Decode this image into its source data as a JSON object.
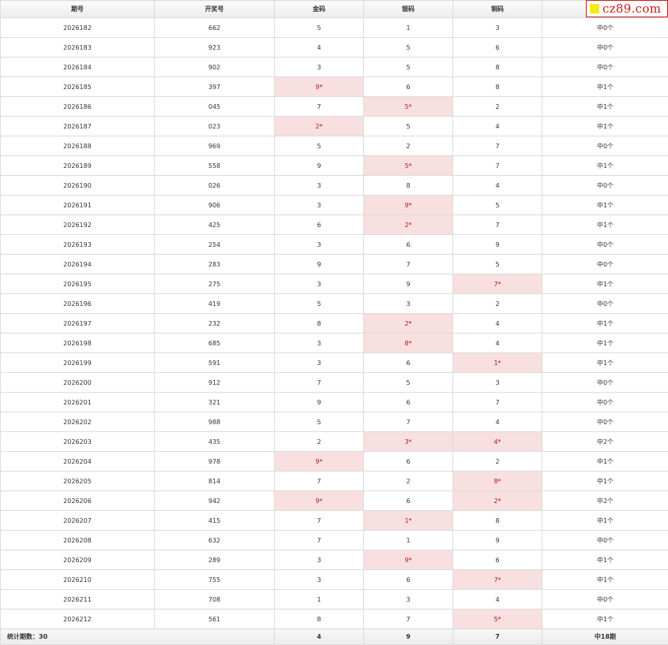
{
  "header": {
    "period": "期号",
    "draw": "开奖号",
    "gold": "金码",
    "silver": "银码",
    "copper": "铜码"
  },
  "watermark": "cz89.com",
  "rows": [
    {
      "p": "2026182",
      "n": "662",
      "g": "5",
      "s": "1",
      "c": "3",
      "r": "中0个",
      "h": ""
    },
    {
      "p": "2026183",
      "n": "923",
      "g": "4",
      "s": "5",
      "c": "6",
      "r": "中0个",
      "h": ""
    },
    {
      "p": "2026184",
      "n": "902",
      "g": "3",
      "s": "5",
      "c": "8",
      "r": "中0个",
      "h": ""
    },
    {
      "p": "2026185",
      "n": "397",
      "g": "9*",
      "s": "6",
      "c": "8",
      "r": "中1个",
      "h": "g"
    },
    {
      "p": "2026186",
      "n": "045",
      "g": "7",
      "s": "5*",
      "c": "2",
      "r": "中1个",
      "h": "s"
    },
    {
      "p": "2026187",
      "n": "023",
      "g": "2*",
      "s": "5",
      "c": "4",
      "r": "中1个",
      "h": "g"
    },
    {
      "p": "2026188",
      "n": "969",
      "g": "5",
      "s": "2",
      "c": "7",
      "r": "中0个",
      "h": ""
    },
    {
      "p": "2026189",
      "n": "558",
      "g": "9",
      "s": "5*",
      "c": "7",
      "r": "中1个",
      "h": "s"
    },
    {
      "p": "2026190",
      "n": "026",
      "g": "3",
      "s": "8",
      "c": "4",
      "r": "中0个",
      "h": ""
    },
    {
      "p": "2026191",
      "n": "906",
      "g": "3",
      "s": "9*",
      "c": "5",
      "r": "中1个",
      "h": "s"
    },
    {
      "p": "2026192",
      "n": "425",
      "g": "6",
      "s": "2*",
      "c": "7",
      "r": "中1个",
      "h": "s"
    },
    {
      "p": "2026193",
      "n": "254",
      "g": "3",
      "s": "6",
      "c": "9",
      "r": "中0个",
      "h": ""
    },
    {
      "p": "2026194",
      "n": "283",
      "g": "9",
      "s": "7",
      "c": "5",
      "r": "中0个",
      "h": ""
    },
    {
      "p": "2026195",
      "n": "275",
      "g": "3",
      "s": "9",
      "c": "7*",
      "r": "中1个",
      "h": "c"
    },
    {
      "p": "2026196",
      "n": "419",
      "g": "5",
      "s": "3",
      "c": "2",
      "r": "中0个",
      "h": ""
    },
    {
      "p": "2026197",
      "n": "232",
      "g": "8",
      "s": "2*",
      "c": "4",
      "r": "中1个",
      "h": "s"
    },
    {
      "p": "2026198",
      "n": "685",
      "g": "3",
      "s": "8*",
      "c": "4",
      "r": "中1个",
      "h": "s"
    },
    {
      "p": "2026199",
      "n": "591",
      "g": "3",
      "s": "6",
      "c": "1*",
      "r": "中1个",
      "h": "c"
    },
    {
      "p": "2026200",
      "n": "912",
      "g": "7",
      "s": "5",
      "c": "3",
      "r": "中0个",
      "h": ""
    },
    {
      "p": "2026201",
      "n": "321",
      "g": "9",
      "s": "6",
      "c": "7",
      "r": "中0个",
      "h": ""
    },
    {
      "p": "2026202",
      "n": "988",
      "g": "5",
      "s": "7",
      "c": "4",
      "r": "中0个",
      "h": ""
    },
    {
      "p": "2026203",
      "n": "435",
      "g": "2",
      "s": "3*",
      "c": "4*",
      "r": "中2个",
      "h": "sc"
    },
    {
      "p": "2026204",
      "n": "978",
      "g": "9*",
      "s": "6",
      "c": "2",
      "r": "中1个",
      "h": "g"
    },
    {
      "p": "2026205",
      "n": "814",
      "g": "7",
      "s": "2",
      "c": "8*",
      "r": "中1个",
      "h": "c"
    },
    {
      "p": "2026206",
      "n": "942",
      "g": "9*",
      "s": "6",
      "c": "2*",
      "r": "中2个",
      "h": "gc"
    },
    {
      "p": "2026207",
      "n": "415",
      "g": "7",
      "s": "1*",
      "c": "8",
      "r": "中1个",
      "h": "s"
    },
    {
      "p": "2026208",
      "n": "632",
      "g": "7",
      "s": "1",
      "c": "9",
      "r": "中0个",
      "h": ""
    },
    {
      "p": "2026209",
      "n": "289",
      "g": "3",
      "s": "9*",
      "c": "6",
      "r": "中1个",
      "h": "s"
    },
    {
      "p": "2026210",
      "n": "755",
      "g": "3",
      "s": "6",
      "c": "7*",
      "r": "中1个",
      "h": "c"
    },
    {
      "p": "2026211",
      "n": "708",
      "g": "1",
      "s": "3",
      "c": "4",
      "r": "中0个",
      "h": ""
    },
    {
      "p": "2026212",
      "n": "561",
      "g": "8",
      "s": "7",
      "c": "5*",
      "r": "中1个",
      "h": "c"
    }
  ],
  "footer": {
    "label": "统计期数：30",
    "gold": "4",
    "silver": "9",
    "copper": "7",
    "total": "中18期"
  }
}
